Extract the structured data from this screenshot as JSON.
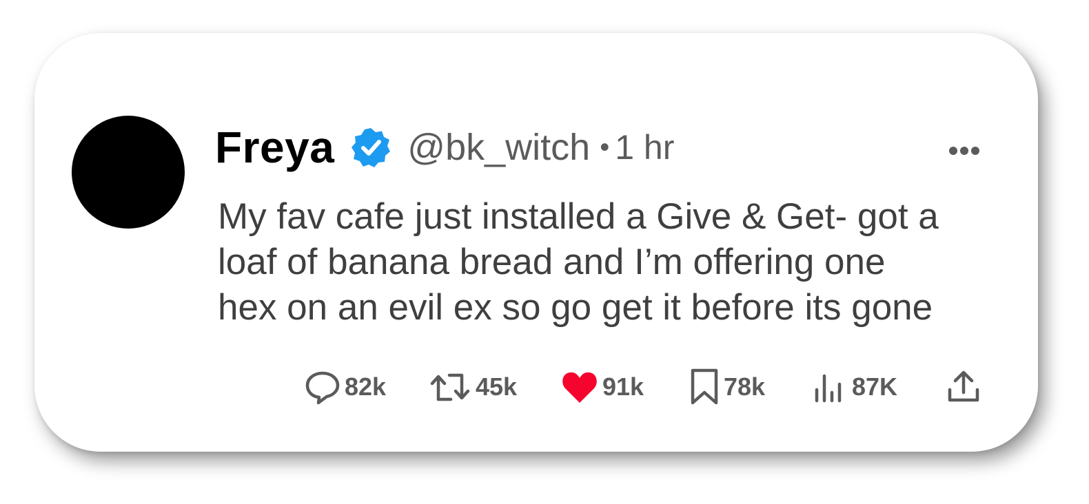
{
  "post": {
    "display_name": "Freya",
    "handle": "@bk_witch",
    "separator": "•",
    "time": "1 hr",
    "body_lines": [
      "My fav cafe just installed a Give & Get- got a",
      "loaf of banana bread and I’m offering one",
      "hex on an evil ex so go get it before its gone"
    ]
  },
  "actions": {
    "replies": "82k",
    "reposts": "45k",
    "likes": "91k",
    "bookmarks": "78k",
    "views": "87K"
  },
  "colors": {
    "verified_badge": "#1d9bf0",
    "like_heart": "#f5052e",
    "secondary_text": "#5b5b5b"
  },
  "icons": [
    "verified-badge-icon",
    "more-options-icon",
    "reply-icon",
    "repost-icon",
    "heart-icon",
    "bookmark-icon",
    "views-icon",
    "share-icon"
  ]
}
